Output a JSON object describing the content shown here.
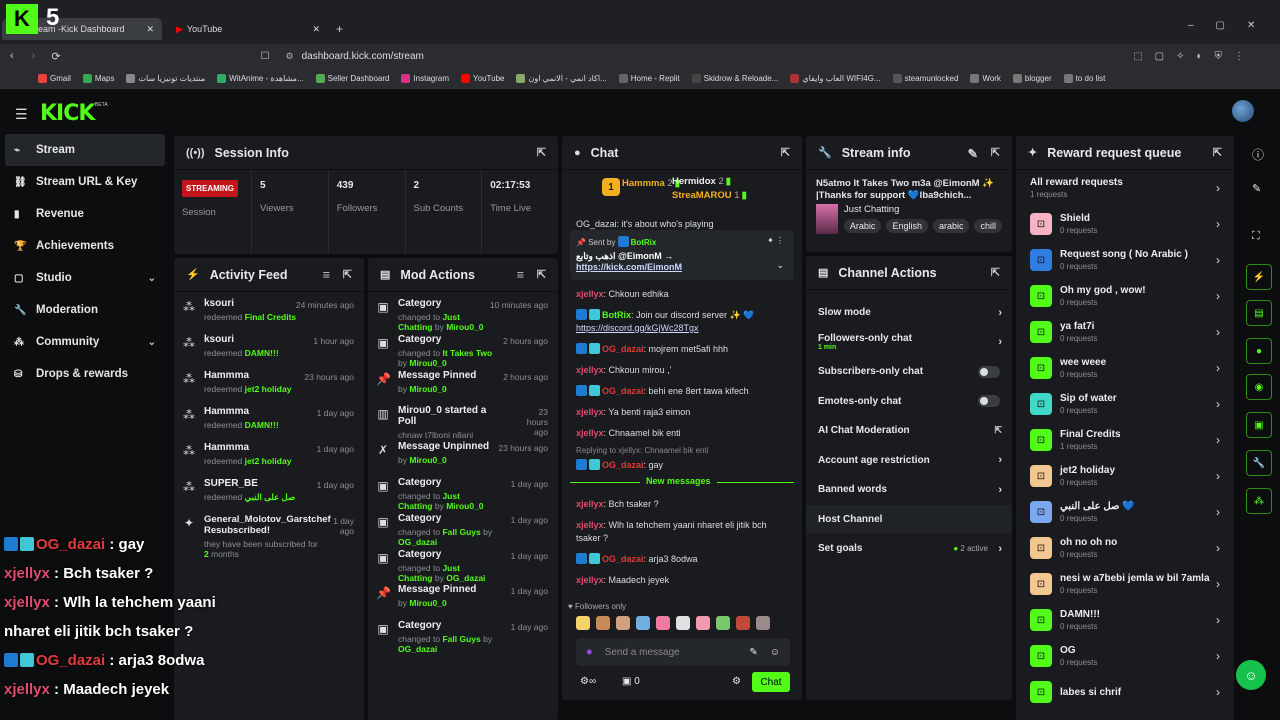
{
  "browser": {
    "tab1": "Kick Dashboard",
    "tab1_prefix": "eam - ",
    "tab2": "YouTube",
    "url": "dashboard.kick.com/stream",
    "bookmarks": [
      "Gmail",
      "Maps",
      "منتديات تونيزيا سات",
      "WitAnime - مشاهدة...",
      "Seller Dashboard",
      "Instagram",
      "YouTube",
      "اكاد انمي - الانمي اون...",
      "Home - Replit",
      "Skidrow & Reloade...",
      "العاب وايفاي WIFI4G...",
      "steamunlocked",
      "Work",
      "blogger",
      "to do list"
    ]
  },
  "overlay": {
    "logo_num": "5"
  },
  "app": {
    "logo": "KICK",
    "beta": "BETA"
  },
  "sidebar": [
    {
      "label": "Stream",
      "icon": "stream-icon"
    },
    {
      "label": "Stream URL & Key",
      "icon": "link-icon"
    },
    {
      "label": "Revenue",
      "icon": "chart-icon"
    },
    {
      "label": "Achievements",
      "icon": "trophy-icon"
    },
    {
      "label": "Studio",
      "icon": "studio-icon"
    },
    {
      "label": "Moderation",
      "icon": "wrench-icon"
    },
    {
      "label": "Community",
      "icon": "community-icon"
    },
    {
      "label": "Drops & rewards",
      "icon": "gift-icon"
    }
  ],
  "session": {
    "title": "Session Info",
    "status": "STREAMING",
    "status_label": "Session",
    "stats": [
      {
        "value": "5",
        "label": "Viewers"
      },
      {
        "value": "439",
        "label": "Followers"
      },
      {
        "value": "2",
        "label": "Sub Counts"
      },
      {
        "value": "02:17:53",
        "label": "Time Live"
      }
    ]
  },
  "activity": {
    "title": "Activity Feed",
    "items": [
      {
        "who": "ksouri",
        "pre": "redeemed",
        "what": "Final Credits",
        "when": "24 minutes ago"
      },
      {
        "who": "ksouri",
        "pre": "redeemed",
        "what": "DAMN!!!",
        "when": "1 hour ago"
      },
      {
        "who": "Hammma",
        "pre": "redeemed",
        "what": "jet2 holiday",
        "when": "23 hours ago"
      },
      {
        "who": "Hammma",
        "pre": "redeemed",
        "what": "DAMN!!!",
        "when": "1 day ago"
      },
      {
        "who": "Hammma",
        "pre": "redeemed",
        "what": "jet2 holiday",
        "when": "1 day ago"
      },
      {
        "who": "SUPER_BE",
        "pre": "redeemed",
        "what": "صل على النبي",
        "when": "1 day ago"
      }
    ],
    "sub": {
      "who": "General_Molotov_Garstchef Resubscribed!",
      "what": "they have been subscribed for",
      "months": "2",
      "unit": "months",
      "when": "1 day ago"
    }
  },
  "mod": {
    "title": "Mod Actions",
    "items": [
      {
        "title": "Category",
        "desc": "changed to",
        "value": "Just Chatting",
        "by": "by",
        "user": "Mirou0_0",
        "when": "10 minutes ago",
        "icon": "category-icon"
      },
      {
        "title": "Category",
        "desc": "changed to",
        "value": "It Takes Two",
        "by": "by",
        "user": "Mirou0_0",
        "when": "2 hours ago",
        "icon": "category-icon"
      },
      {
        "title": "Message Pinned",
        "desc": "by",
        "value": "",
        "by": "",
        "user": "Mirou0_0",
        "when": "2 hours ago",
        "icon": "pin-icon"
      },
      {
        "title": "Mirou0_0 started a Poll",
        "desc": "chnaw t7lboni n8ani",
        "value": "",
        "by": "",
        "user": "",
        "when": "23 hours ago",
        "icon": "poll-icon"
      },
      {
        "title": "Message Unpinned",
        "desc": "by",
        "value": "",
        "by": "",
        "user": "Mirou0_0",
        "when": "23 hours ago",
        "icon": "unpin-icon"
      },
      {
        "title": "Category",
        "desc": "changed to",
        "value": "Just Chatting",
        "by": "by",
        "user": "Mirou0_0",
        "when": "1 day ago",
        "icon": "category-icon"
      },
      {
        "title": "Category",
        "desc": "changed to",
        "value": "Fall Guys",
        "by": "by",
        "user": "OG_dazai",
        "when": "1 day ago",
        "icon": "category-icon"
      },
      {
        "title": "Category",
        "desc": "changed to",
        "value": "Just Chatting",
        "by": "by",
        "user": "OG_dazai",
        "when": "1 day ago",
        "icon": "category-icon"
      },
      {
        "title": "Message Pinned",
        "desc": "by",
        "value": "",
        "by": "",
        "user": "Mirou0_0",
        "when": "1 day ago",
        "icon": "pin-icon"
      },
      {
        "title": "Category",
        "desc": "changed to",
        "value": "Fall Guys",
        "by": "by",
        "user": "OG_dazai",
        "when": "1 day ago",
        "icon": "category-icon"
      }
    ]
  },
  "chat": {
    "title": "Chat",
    "top": [
      {
        "name": "Hammma",
        "count": "2"
      },
      {
        "name": "Hermidox",
        "count": "2"
      },
      {
        "name": "StreaMAROU",
        "count": "1"
      }
    ],
    "rank": "1",
    "partial": "OG_dazai: it's about who's playing",
    "pinned": {
      "label": "Sent by",
      "user": "BotRix",
      "text": "اذهب وتابع @EimonM →",
      "link": "https://kick.com/EimonM"
    },
    "msgs": [
      {
        "user": "xjellyx",
        "text": "Chkoun edhika",
        "badge": false
      },
      {
        "user": "BotRix",
        "text": "Join our discord server ✨ 💙",
        "link": "https://discord.gg/kGjWc28Tgx",
        "badge": true
      },
      {
        "user": "OG_dazai",
        "text": "mojrem met5afi hhh",
        "badge": true
      },
      {
        "user": "xjellyx",
        "text": "Chkoun mirou ,'",
        "badge": false
      },
      {
        "user": "OG_dazai",
        "text": "behi ene 8ert tawa kifech",
        "badge": true
      },
      {
        "user": "xjellyx",
        "text": "Ya benti raja3 eimon",
        "badge": false
      },
      {
        "user": "xjellyx",
        "text": "Chnaamel bik enti",
        "badge": false
      }
    ],
    "reply": "Replying to xjellyx: Chnaamel bik enti",
    "reply_msg": {
      "user": "OG_dazai",
      "text": "gay"
    },
    "new": "New messages",
    "msgs2": [
      {
        "user": "xjellyx",
        "text": "Bch tsaker ?",
        "badge": false
      },
      {
        "user": "xjellyx",
        "text": "Wlh la tehchem yaani nharet eli jitik bch tsaker ?",
        "badge": false
      },
      {
        "user": "OG_dazai",
        "text": "arja3 8odwa",
        "badge": true
      },
      {
        "user": "xjellyx",
        "text": "Maadech jeyek",
        "badge": false
      }
    ],
    "followers_only": "Followers only",
    "placeholder": "Send a message",
    "count": "0",
    "send": "Chat"
  },
  "streaminfo": {
    "title": "Stream info",
    "text": "N5atmo It Takes Two m3a @EimonM ✨ |Thanks for support 💙lba9chich...",
    "category": "Just Chatting",
    "tags": [
      "Arabic",
      "English",
      "arabic",
      "chill"
    ]
  },
  "actions": {
    "title": "Channel Actions",
    "rows": [
      {
        "label": "Slow mode",
        "type": "chev"
      },
      {
        "label": "Followers-only chat",
        "sub": "1 min",
        "type": "chev"
      },
      {
        "label": "Subscribers-only chat",
        "type": "toggle"
      },
      {
        "label": "Emotes-only chat",
        "type": "toggle"
      },
      {
        "label": "AI Chat Moderation",
        "type": "ext"
      },
      {
        "label": "Account age restriction",
        "type": "chev"
      },
      {
        "label": "Banned words",
        "type": "chev"
      },
      {
        "label": "Host Channel",
        "type": "none"
      },
      {
        "label": "Set goals",
        "type": "chev",
        "extra": "2 active"
      }
    ]
  },
  "rewards": {
    "title": "Reward request queue",
    "all": "All reward requests",
    "all_sub": "1 requests",
    "items": [
      {
        "name": "Shield",
        "req": "0 requests",
        "color": "#f5b3c4"
      },
      {
        "name": "Request song ( No Arabic )",
        "req": "0 requests",
        "color": "#2f7de0"
      },
      {
        "name": "Oh my god , wow!",
        "req": "0 requests",
        "color": "#53fc18"
      },
      {
        "name": "ya fat7i",
        "req": "0 requests",
        "color": "#53fc18"
      },
      {
        "name": "wee weee",
        "req": "0 requests",
        "color": "#53fc18"
      },
      {
        "name": "Sip of water",
        "req": "0 requests",
        "color": "#40d8c8"
      },
      {
        "name": "Final Credits",
        "req": "1 requests",
        "color": "#53fc18"
      },
      {
        "name": "jet2 holiday",
        "req": "0 requests",
        "color": "#f5c790"
      },
      {
        "name": "صل على النبي 💙",
        "req": "0 requests",
        "color": "#7aa8ef"
      },
      {
        "name": "oh no oh no",
        "req": "0 requests",
        "color": "#f5c790"
      },
      {
        "name": "nesi w a7bebi jemla w bil 7amla",
        "req": "0 requests",
        "color": "#f5c790"
      },
      {
        "name": "DAMN!!!",
        "req": "0 requests",
        "color": "#53fc18"
      },
      {
        "name": "OG",
        "req": "0 requests",
        "color": "#53fc18"
      },
      {
        "name": "labes si chrif",
        "req": "",
        "color": "#53fc18"
      }
    ]
  },
  "overlay_chat": [
    {
      "user": "OG_dazai",
      "text": ": gay"
    },
    {
      "user": "xjellyx",
      "text": ": Bch tsaker ?"
    },
    {
      "user": "xjellyx",
      "text": ": Wlh la tehchem yaani"
    },
    {
      "user": "",
      "text": "nharet eli jitik bch tsaker ?"
    },
    {
      "user": "OG_dazai",
      "text": ": arja3 8odwa"
    },
    {
      "user": "xjellyx",
      "text": ": Maadech jeyek"
    }
  ]
}
